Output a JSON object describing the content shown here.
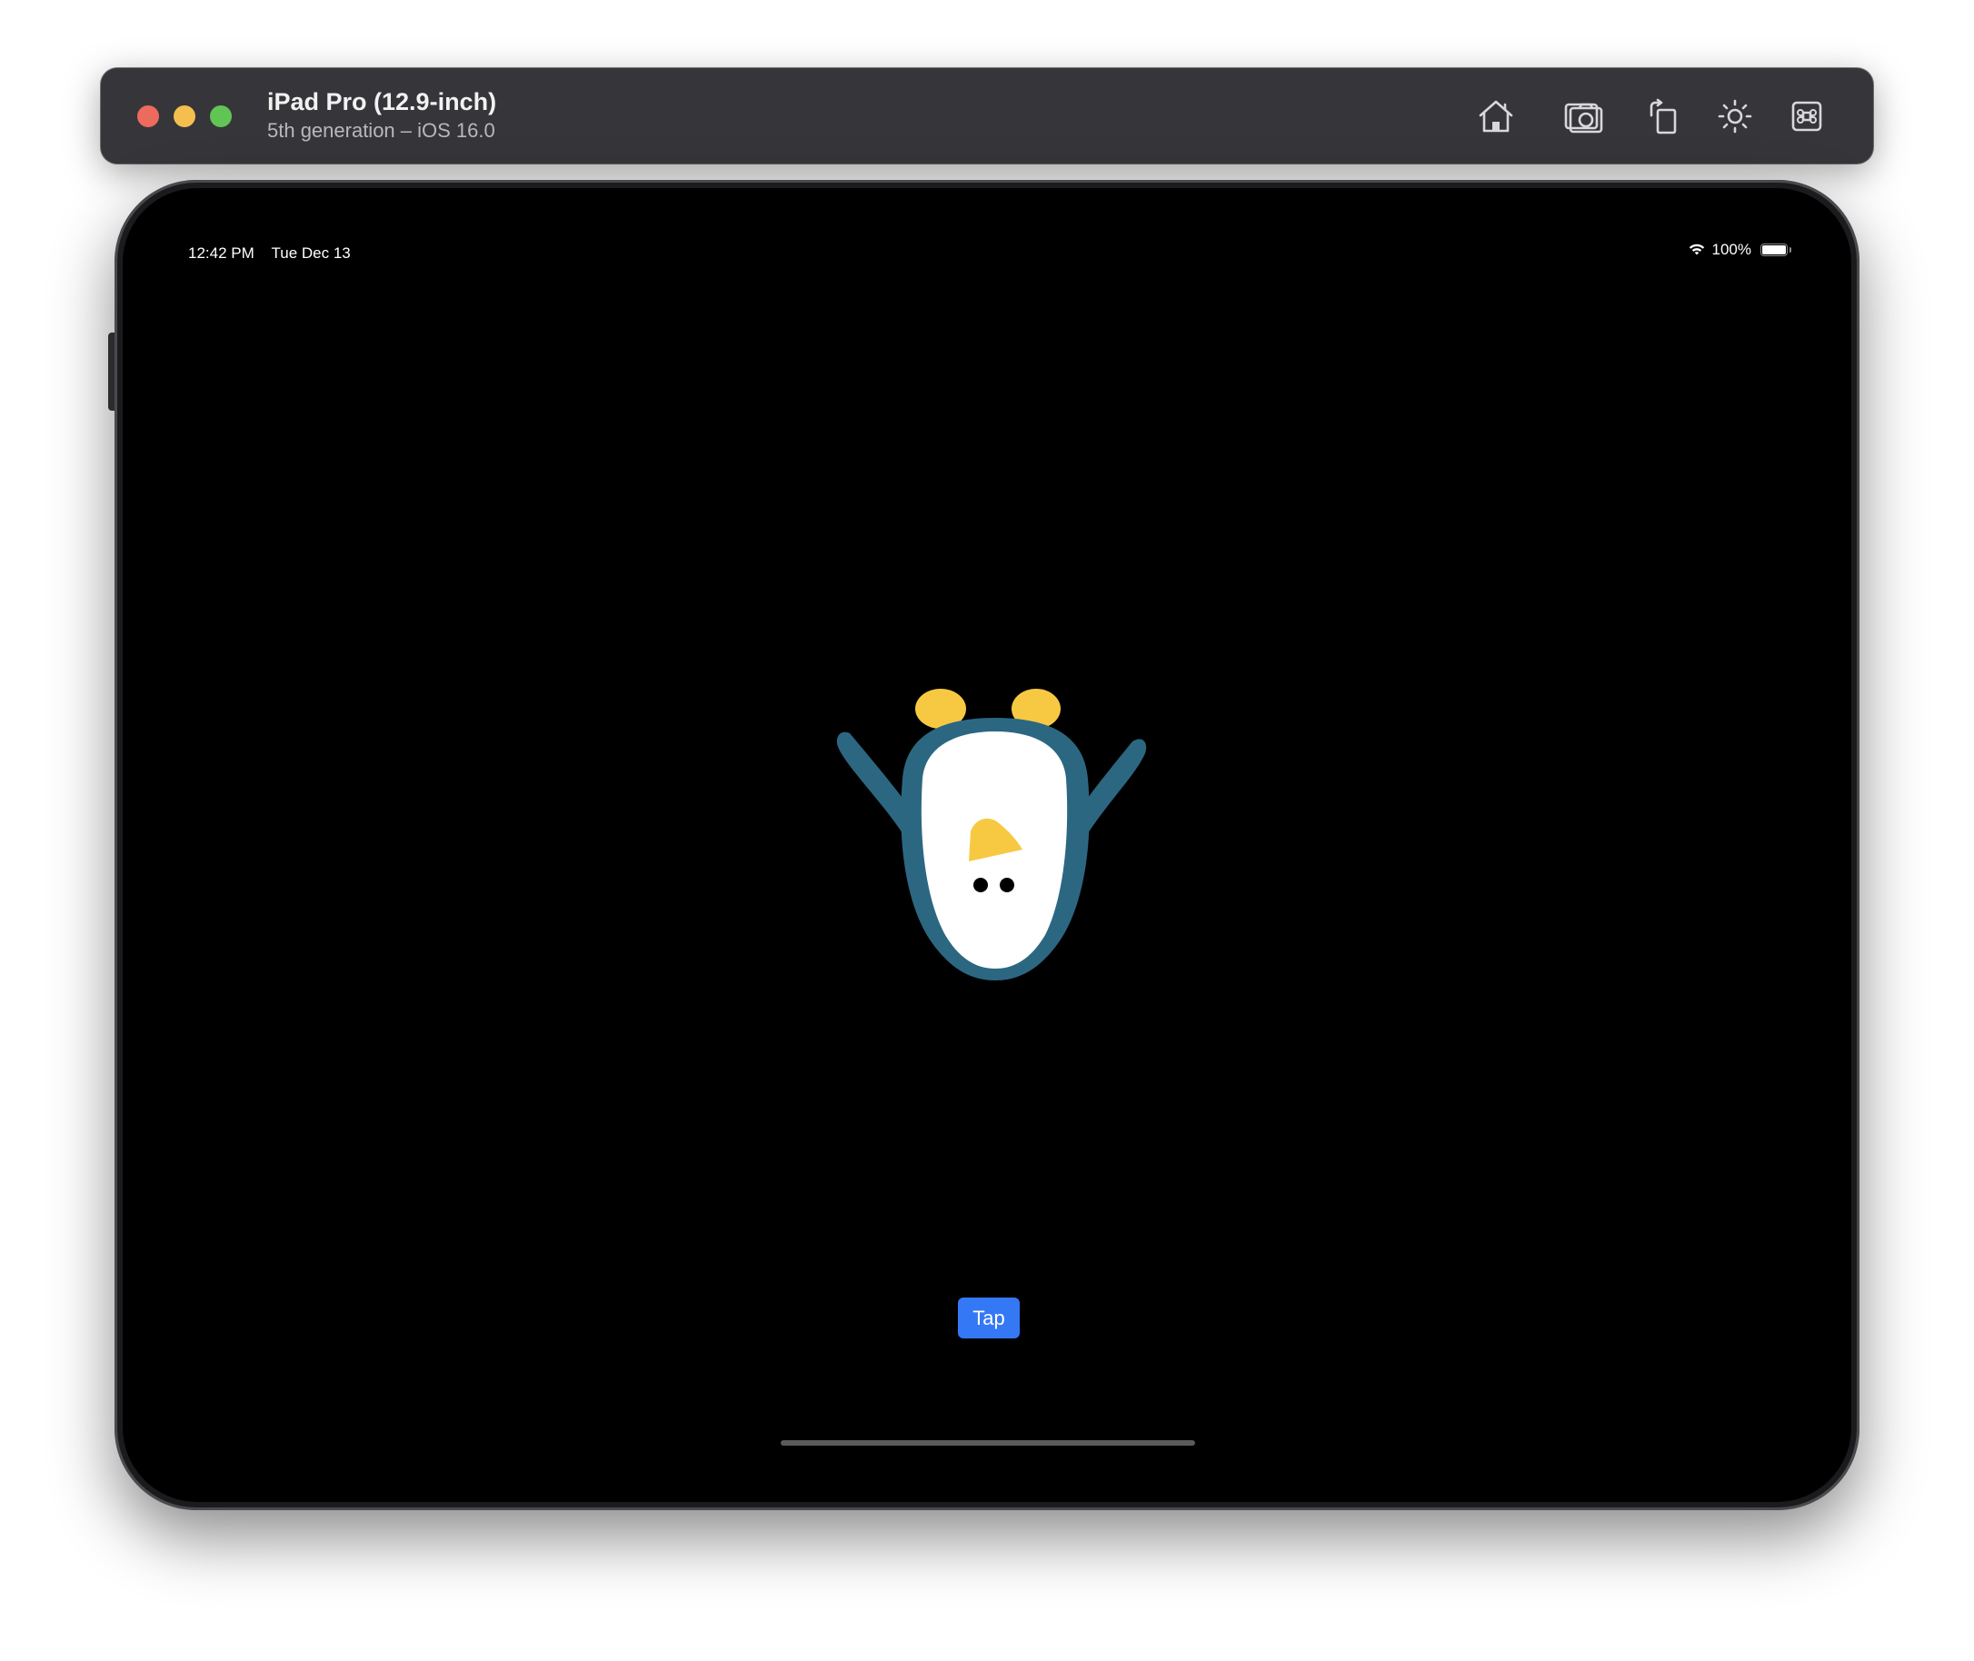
{
  "window": {
    "title": "iPad Pro (12.9-inch)",
    "subtitle": "5th generation – iOS 16.0",
    "toolbar_icons": [
      "home-icon",
      "screenshot-icon",
      "rotate-icon",
      "appearance-icon",
      "keyboard-shortcut-icon"
    ]
  },
  "status_bar": {
    "time": "12:42 PM",
    "date": "Tue Dec 13",
    "battery": "100%",
    "battery_level": 1.0
  },
  "app": {
    "tap_button_label": "Tap",
    "illustration": "penguin (upside down)"
  },
  "colors": {
    "penguin_body": "#2c6782",
    "penguin_belly": "#ffffff",
    "penguin_beak_feet": "#f7c942",
    "tap_button": "#3478f6",
    "screen_background": "#000000"
  }
}
